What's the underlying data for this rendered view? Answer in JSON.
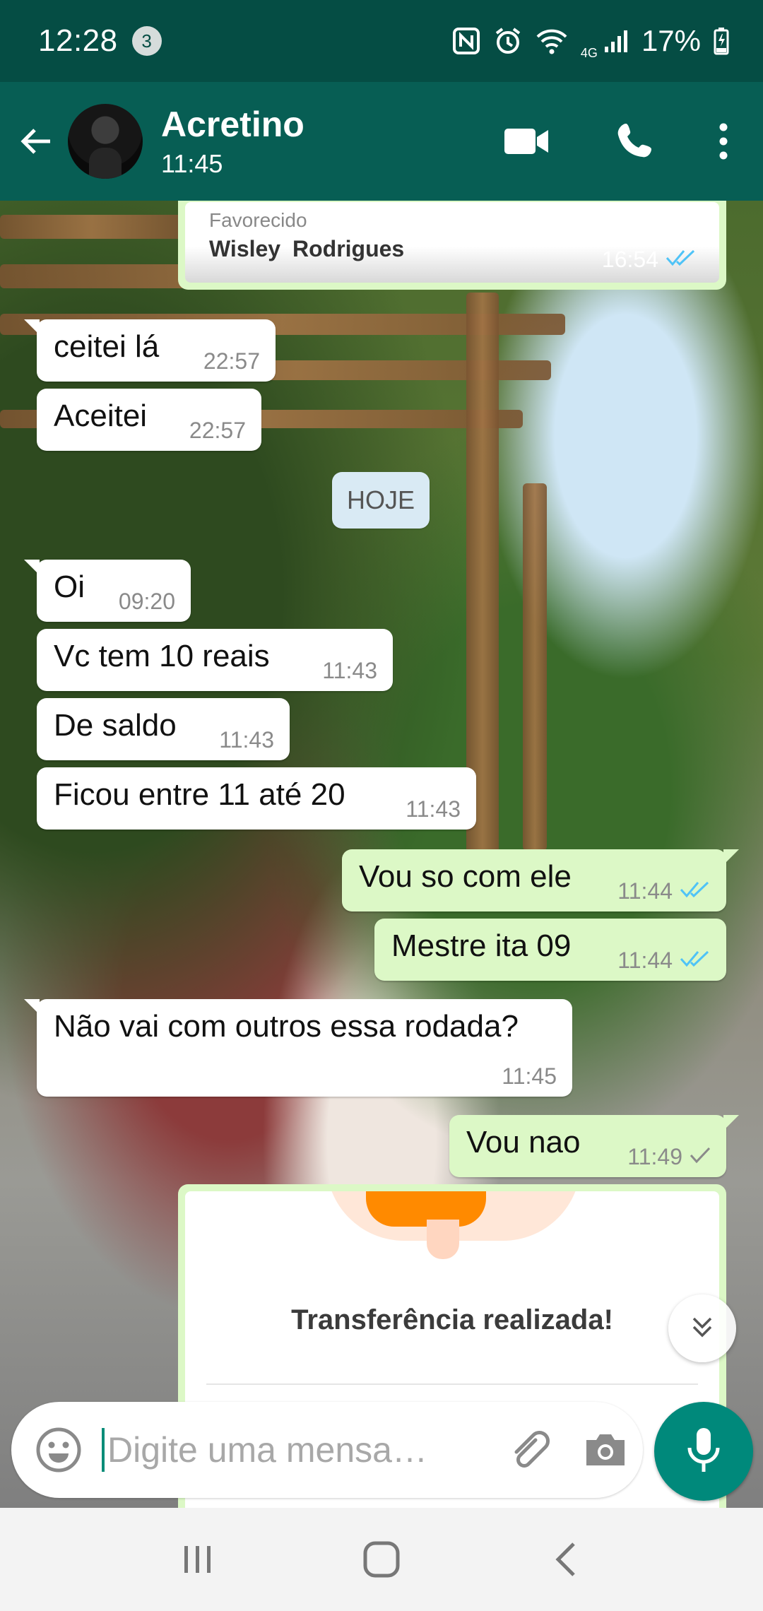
{
  "status_bar": {
    "time": "12:28",
    "notification_count": "3",
    "network": "4G",
    "battery": "17%"
  },
  "header": {
    "contact_name": "Acretino",
    "contact_status": "11:45",
    "icons": [
      "back-arrow-icon",
      "video-call-icon",
      "phone-icon",
      "more-options-icon"
    ]
  },
  "chat": {
    "receipt_top": {
      "label": "Favorecido",
      "name": "Wisley  Rodrigues",
      "time": "16:54",
      "status": "read"
    },
    "date_divider": "HOJE",
    "messages": [
      {
        "direction": "in",
        "text": "ceitei lá",
        "time": "22:57"
      },
      {
        "direction": "in",
        "text": "Aceitei",
        "time": "22:57"
      },
      {
        "direction": "in",
        "text": "Oi",
        "time": "09:20"
      },
      {
        "direction": "in",
        "text": "Vc tem 10 reais",
        "time": "11:43"
      },
      {
        "direction": "in",
        "text": "De saldo",
        "time": "11:43"
      },
      {
        "direction": "in",
        "text": "Ficou entre 11 até 20",
        "time": "11:43"
      },
      {
        "direction": "out",
        "text": "Vou so com ele",
        "time": "11:44",
        "status": "read"
      },
      {
        "direction": "out",
        "text": "Mestre ita 09",
        "time": "11:44",
        "status": "read"
      },
      {
        "direction": "in",
        "text": "Não vai com outros essa rodada?",
        "time": "11:45"
      },
      {
        "direction": "out",
        "text": "Vou nao",
        "time": "11:49",
        "status": "sent"
      }
    ],
    "receipt_bottom": {
      "title": "Transferência realizada!"
    }
  },
  "composer": {
    "placeholder": "Digite uma mensa…"
  },
  "colors": {
    "header": "#075e54",
    "status_bar": "#054d44",
    "outgoing_bubble": "#dcf8c6",
    "incoming_bubble": "#ffffff",
    "read_ticks": "#4fc3f7",
    "mic_button": "#00897b"
  }
}
